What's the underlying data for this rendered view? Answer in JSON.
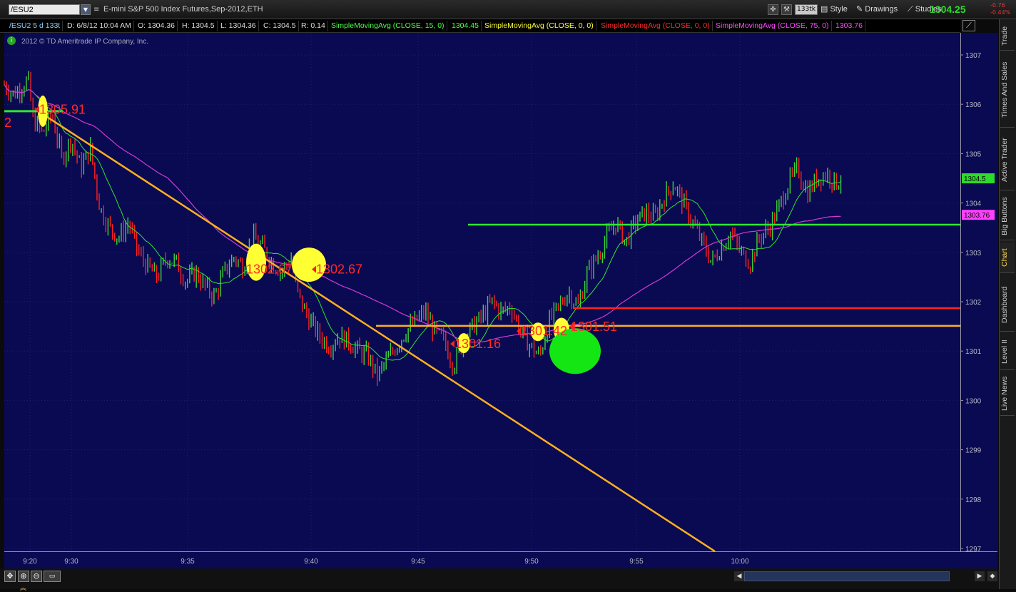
{
  "toolbar": {
    "symbol": "/ESU2",
    "description": "E-mini S&P 500 Index Futures,Sep-2012,ETH",
    "aggregation": "133tk",
    "style": "Style",
    "drawings": "Drawings",
    "studies": "Studies",
    "last_price": "1304.25",
    "change": "-0.76",
    "change_pct": "-0.44%"
  },
  "info_bar": {
    "symbol_period": "/ESU2 5 d 133t",
    "date": "D: 6/8/12 10:04 AM",
    "open": "O: 1304.36",
    "high": "H: 1304.5",
    "low": "L: 1304.36",
    "close": "C: 1304.5",
    "range": "R: 0.14",
    "studies": [
      {
        "label": "SimpleMovingAvg (CLOSE, 15, 0)",
        "value": "1304.45",
        "color": "#4cff4c"
      },
      {
        "label": "SimpleMovingAvg (CLOSE, 0, 0)",
        "value": "",
        "color": "#ffff40"
      },
      {
        "label": "SimpleMovingAvg (CLOSE, 0, 0)",
        "value": "",
        "color": "#ff2b2b"
      },
      {
        "label": "SimpleMovingAvg (CLOSE, 75, 0)",
        "value": "1303.76",
        "color": "#ff4cff"
      }
    ]
  },
  "copyright": "2012 © TD Ameritrade IP Company, Inc.",
  "side_tabs": [
    "Trade",
    "Times And Sales",
    "Active Trader",
    "Big Buttons",
    "Chart",
    "Dashboard",
    "Level II",
    "Live News"
  ],
  "active_tab": "Chart",
  "colors": {
    "plot_bg": "#0a0a52",
    "up": "#3bd43b",
    "down": "#ff2020",
    "sma15": "#31e331",
    "sma75": "#d23ad2",
    "trend": "#ffb020",
    "ellipse": "#ffff33",
    "big_dot": "#14e614"
  },
  "chart_data": {
    "type": "candlestick",
    "ylim": [
      1296.9,
      1307.4
    ],
    "y_ticks": [
      1297,
      1298,
      1299,
      1300,
      1301,
      1302,
      1303,
      1304,
      1305,
      1306,
      1307
    ],
    "x_ticks": [
      "9:20",
      "9:30",
      "9:35",
      "9:40",
      "9:45",
      "9:50",
      "9:55",
      "10:00"
    ],
    "price_tags": [
      {
        "value": "1304.5",
        "price": 1304.5,
        "bg": "#2bdc2b",
        "fg": "#000"
      },
      {
        "value": "1303.76",
        "price": 1303.76,
        "bg": "#ff40ff",
        "fg": "#000"
      }
    ],
    "annotations": [
      {
        "text": "1305.91"
      },
      {
        "text": "1302.67"
      },
      {
        "text": "1302.67"
      },
      {
        "text": "1301.42"
      },
      {
        "text": "1301.16"
      },
      {
        "text": "1301.51"
      },
      {
        "text": "2"
      }
    ],
    "close_path": [
      [
        0,
        1306.4
      ],
      [
        0.01,
        1306.2
      ],
      [
        0.025,
        1306.5
      ],
      [
        0.03,
        1305.7
      ],
      [
        0.04,
        1305.4
      ],
      [
        0.05,
        1305.8
      ],
      [
        0.06,
        1304.9
      ],
      [
        0.07,
        1305.3
      ],
      [
        0.08,
        1304.7
      ],
      [
        0.09,
        1305.1
      ],
      [
        0.1,
        1303.9
      ],
      [
        0.11,
        1303.5
      ],
      [
        0.12,
        1303.3
      ],
      [
        0.13,
        1303.6
      ],
      [
        0.14,
        1303.0
      ],
      [
        0.15,
        1302.7
      ],
      [
        0.16,
        1302.5
      ],
      [
        0.17,
        1302.9
      ],
      [
        0.18,
        1302.8
      ],
      [
        0.19,
        1302.4
      ],
      [
        0.2,
        1302.6
      ],
      [
        0.21,
        1302.3
      ],
      [
        0.22,
        1302.1
      ],
      [
        0.23,
        1302.6
      ],
      [
        0.24,
        1302.9
      ],
      [
        0.25,
        1302.7
      ],
      [
        0.26,
        1303.3
      ],
      [
        0.27,
        1303.1
      ],
      [
        0.28,
        1302.8
      ],
      [
        0.29,
        1302.6
      ],
      [
        0.3,
        1302.9
      ],
      [
        0.305,
        1302.3
      ],
      [
        0.31,
        1302.0
      ],
      [
        0.32,
        1301.6
      ],
      [
        0.33,
        1301.3
      ],
      [
        0.34,
        1301.1
      ],
      [
        0.35,
        1301.3
      ],
      [
        0.36,
        1301.2
      ],
      [
        0.37,
        1301.0
      ],
      [
        0.38,
        1300.9
      ],
      [
        0.39,
        1300.5
      ],
      [
        0.4,
        1300.8
      ],
      [
        0.41,
        1301.1
      ],
      [
        0.42,
        1301.4
      ],
      [
        0.43,
        1301.6
      ],
      [
        0.44,
        1301.8
      ],
      [
        0.45,
        1301.4
      ],
      [
        0.46,
        1301.2
      ],
      [
        0.47,
        1300.7
      ],
      [
        0.48,
        1301.2
      ],
      [
        0.49,
        1301.5
      ],
      [
        0.5,
        1301.7
      ],
      [
        0.51,
        1302.0
      ],
      [
        0.52,
        1301.8
      ],
      [
        0.53,
        1301.9
      ],
      [
        0.54,
        1301.4
      ],
      [
        0.55,
        1301.1
      ],
      [
        0.56,
        1300.9
      ],
      [
        0.57,
        1301.6
      ],
      [
        0.58,
        1301.9
      ],
      [
        0.59,
        1302.2
      ],
      [
        0.6,
        1301.9
      ],
      [
        0.61,
        1302.6
      ],
      [
        0.62,
        1302.9
      ],
      [
        0.63,
        1303.3
      ],
      [
        0.64,
        1303.6
      ],
      [
        0.65,
        1303.2
      ],
      [
        0.66,
        1303.6
      ],
      [
        0.67,
        1303.8
      ],
      [
        0.68,
        1303.7
      ],
      [
        0.69,
        1304.1
      ],
      [
        0.7,
        1304.4
      ],
      [
        0.71,
        1304.0
      ],
      [
        0.72,
        1303.6
      ],
      [
        0.73,
        1303.2
      ],
      [
        0.74,
        1302.8
      ],
      [
        0.75,
        1303.1
      ],
      [
        0.76,
        1303.4
      ],
      [
        0.77,
        1303.0
      ],
      [
        0.78,
        1302.8
      ],
      [
        0.79,
        1303.3
      ],
      [
        0.8,
        1303.5
      ],
      [
        0.81,
        1303.9
      ],
      [
        0.82,
        1304.4
      ],
      [
        0.83,
        1304.7
      ],
      [
        0.84,
        1304.2
      ],
      [
        0.85,
        1304.5
      ],
      [
        0.86,
        1304.6
      ],
      [
        0.87,
        1304.4
      ],
      [
        0.875,
        1304.5
      ]
    ]
  }
}
